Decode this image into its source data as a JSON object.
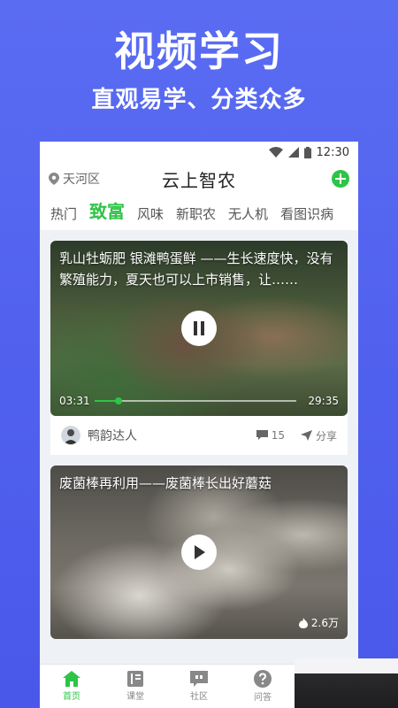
{
  "promo": {
    "title": "视频学习",
    "subtitle": "直观易学、分类众多"
  },
  "statusbar": {
    "time": "12:30",
    "icons": [
      "wifi-icon",
      "signal-icon",
      "battery-icon"
    ]
  },
  "topbar": {
    "location": "天河区",
    "app_name": "云上智农",
    "add_icon": "plus"
  },
  "tabs": [
    {
      "label": "热门",
      "active": false
    },
    {
      "label": "致富",
      "active": true
    },
    {
      "label": "风味",
      "active": false
    },
    {
      "label": "新职农",
      "active": false
    },
    {
      "label": "无人机",
      "active": false
    },
    {
      "label": "看图识病",
      "active": false
    }
  ],
  "feed": [
    {
      "title": "乳山牡蛎肥 银滩鸭蛋鲜 ——生长速度快，没有繁殖能力，夏天也可以上市销售，让……",
      "current_time": "03:31",
      "duration": "29:35",
      "progress": 0.12,
      "state": "playing",
      "author": "鸭韵达人",
      "comments": "15",
      "share_label": "分享"
    },
    {
      "title": "废菌棒再利用——废菌棒长出好蘑菇",
      "views": "2.6万",
      "state": "paused"
    }
  ],
  "bottom_nav": [
    {
      "label": "首页",
      "icon": "home-icon",
      "active": true
    },
    {
      "label": "课堂",
      "icon": "book-icon",
      "active": false
    },
    {
      "label": "社区",
      "icon": "chat-quote-icon",
      "active": false
    },
    {
      "label": "问答",
      "icon": "question-icon",
      "active": false
    }
  ],
  "colors": {
    "accent": "#2ec447",
    "background": "#5a6cf2"
  }
}
